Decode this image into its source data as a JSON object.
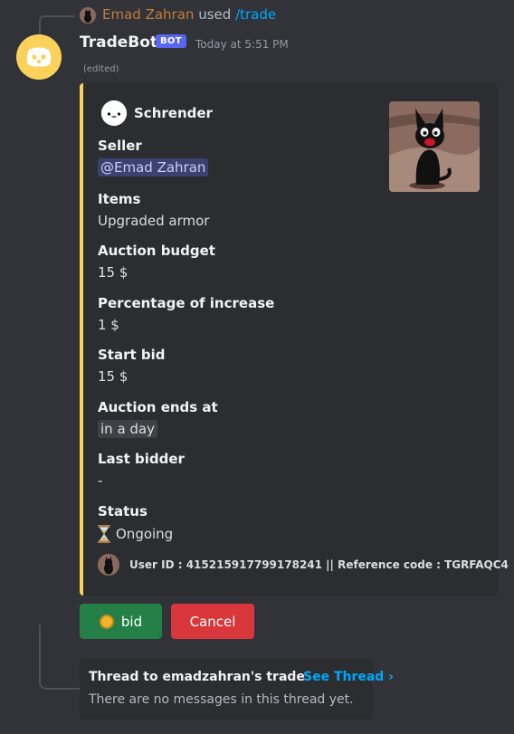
{
  "reply": {
    "username": "Emad Zahran",
    "used_text": "used",
    "command": "/trade"
  },
  "message": {
    "author": "TradeBot",
    "bot_tag": "BOT",
    "timestamp": "Today at 5:51 PM",
    "edited": "(edited)"
  },
  "embed": {
    "accent_color": "#fad15a",
    "author_name": "Schrender",
    "fields": [
      {
        "name": "Seller",
        "value": "@Emad Zahran"
      },
      {
        "name": "Items",
        "value": "Upgraded armor"
      },
      {
        "name": "Auction budget",
        "value": "15 $"
      },
      {
        "name": "Percentage of increase",
        "value": "1 $"
      },
      {
        "name": "Start bid",
        "value": "15 $"
      },
      {
        "name": "Auction ends at",
        "value": "in a day"
      },
      {
        "name": "Last bidder",
        "value": "-"
      },
      {
        "name": "Status",
        "value": "Ongoing"
      }
    ],
    "footer": "User ID : 415215917799178241 || Reference code : TGRFAQC4"
  },
  "buttons": {
    "bid_label": "bid",
    "cancel_label": "Cancel",
    "bid_color": "#248046",
    "cancel_color": "#da373c"
  },
  "thread": {
    "name": "Thread to emadzahran's trade",
    "link_label": "See Thread ›",
    "empty_text": "There are no messages in this thread yet."
  },
  "icons": {
    "status": "hourglass-icon",
    "bid": "coin-icon",
    "bot_avatar": "discord-bot-icon"
  }
}
